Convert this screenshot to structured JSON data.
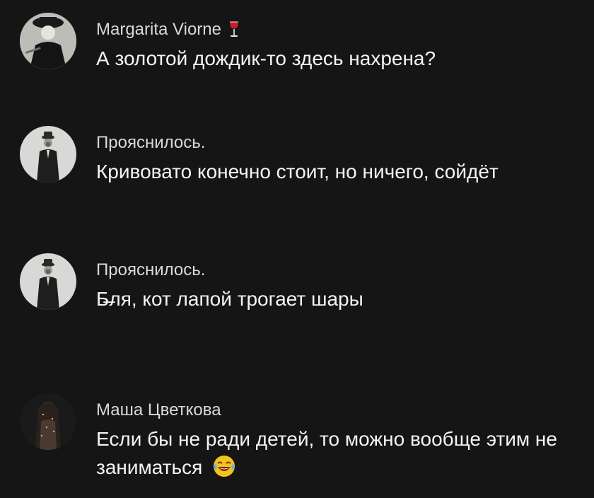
{
  "comments": [
    {
      "author": "Margarita Viorne",
      "author_emoji": "wine-glass-icon",
      "text": "А золотой дождик-то здесь нахрена?"
    },
    {
      "author": "Прояснилось.",
      "text": "Кривовато конечно стоит, но ничего, сойдёт"
    },
    {
      "author": "Прояснилось.",
      "text": "Б̶ля, кот лапой трогает шары"
    },
    {
      "author": "Маша Цветкова",
      "text": "Если бы не ради детей, то можно вообще этим не заниматься",
      "trailing_emoji": "laughing-tears-icon"
    }
  ],
  "colors": {
    "background": "#151515",
    "author": "#d9d9d9",
    "text": "#f4f4f4"
  }
}
